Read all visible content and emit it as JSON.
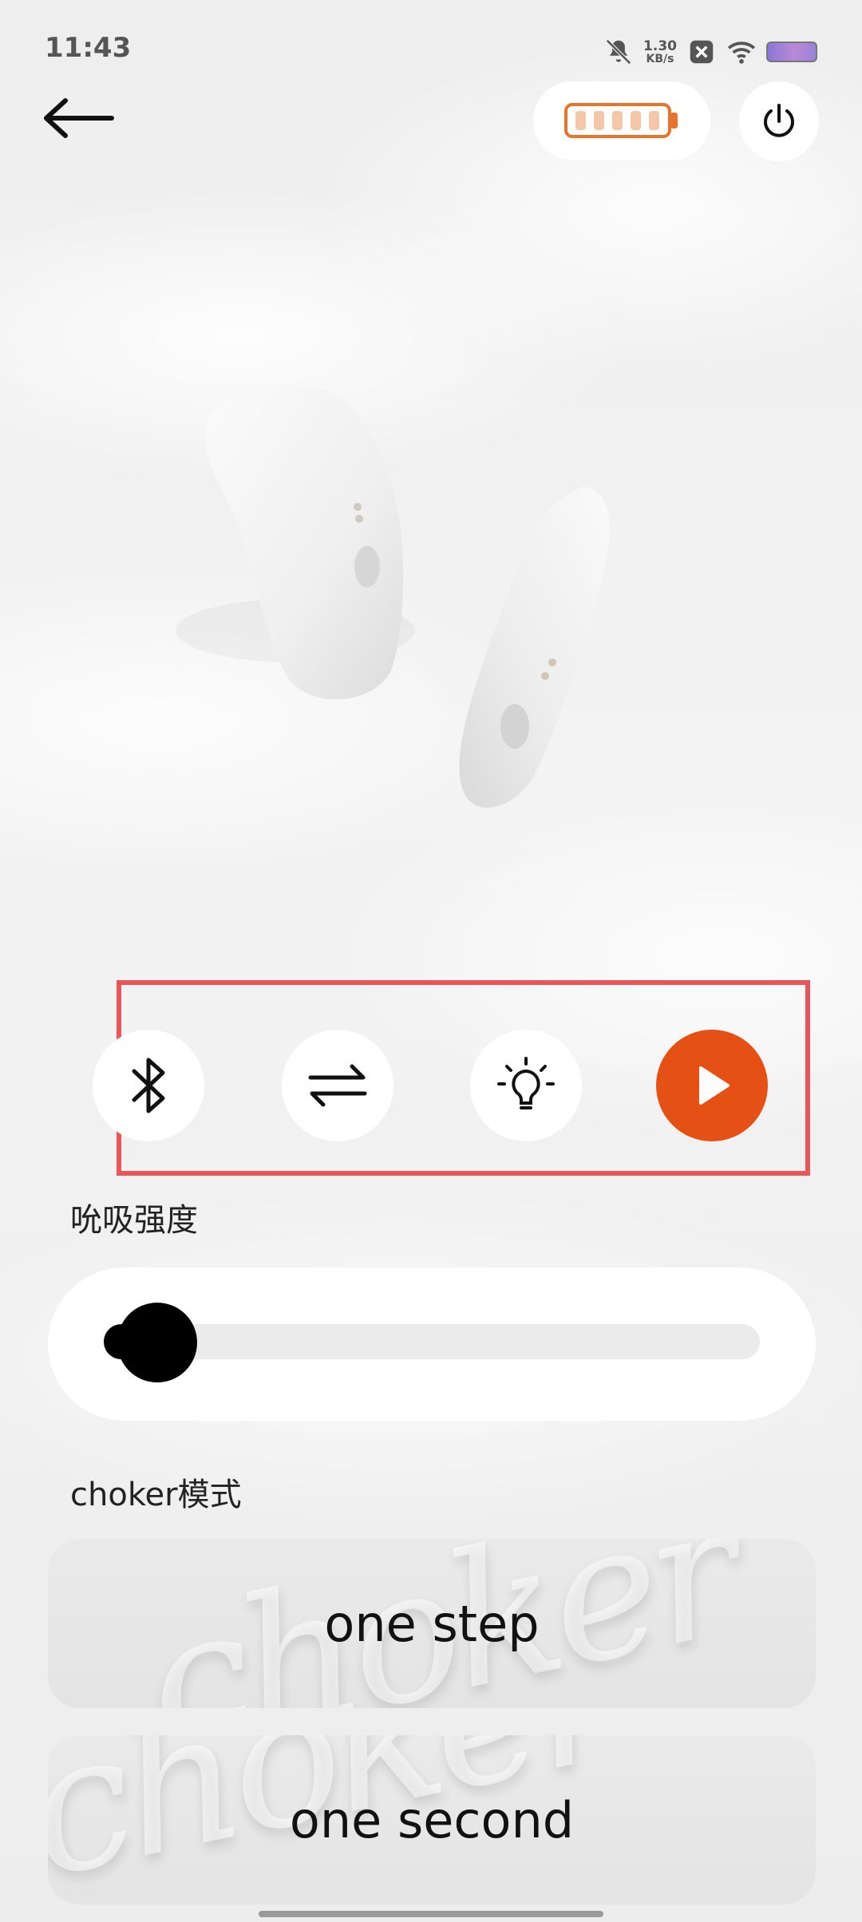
{
  "status_bar": {
    "time": "11:43",
    "net_speed_value": "1.30",
    "net_speed_unit": "KB/s",
    "icons": [
      "mute-icon",
      "close-box-icon",
      "wifi-icon",
      "battery-icon"
    ]
  },
  "header": {
    "back_icon": "arrow-left-icon",
    "battery_icon": "battery-level-icon",
    "battery_color": "#e8742c",
    "power_icon": "power-icon"
  },
  "controls": [
    {
      "name": "bluetooth",
      "icon": "bluetooth-icon"
    },
    {
      "name": "switch",
      "icon": "swap-arrows-icon"
    },
    {
      "name": "light",
      "icon": "lightbulb-icon"
    },
    {
      "name": "play",
      "icon": "play-icon",
      "color": "#e55014"
    }
  ],
  "suction": {
    "label": "吮吸强度",
    "level": 0.05
  },
  "choker": {
    "label": "choker模式",
    "modes": [
      "one step",
      "one second"
    ],
    "watermark": "choker"
  },
  "colors": {
    "accent": "#e55014",
    "highlight_frame": "#e8565a"
  }
}
